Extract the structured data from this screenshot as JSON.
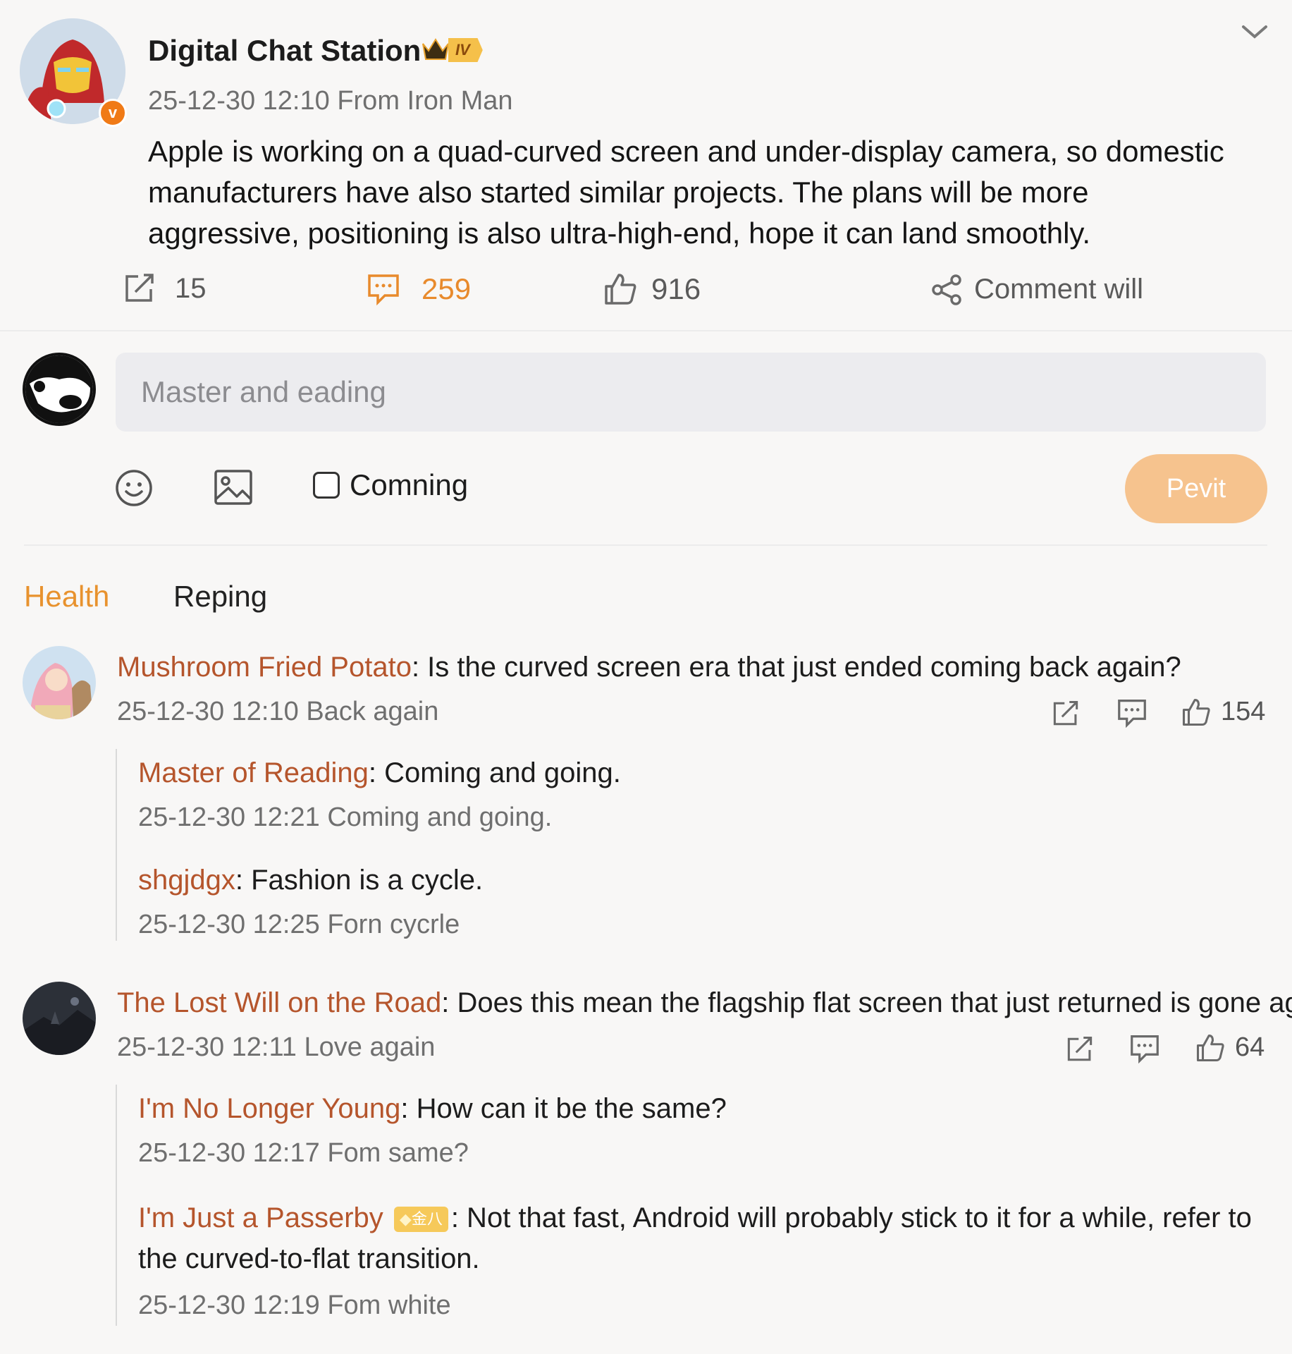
{
  "post": {
    "author": "Digital Chat Station",
    "level_badge": "IV",
    "meta": "25-12-30 12:10 From Iron Man",
    "body": "Apple is working on a quad-curved screen and under-display camera, so domestic manufacturers have also started similar projects. The plans will be more aggressive, positioning is also ultra-high-end, hope it can land smoothly.",
    "actions": {
      "repost_count": "15",
      "comment_count": "259",
      "like_count": "916",
      "share_label": "Comment will"
    },
    "colors": {
      "accent": "#f0a052",
      "link": "#b5552c",
      "comment_count": "#e88a2c"
    }
  },
  "composer": {
    "placeholder": "Master and eading",
    "checkbox_label": "Comning",
    "submit_label": "Pevit"
  },
  "tabs": [
    {
      "label": "Health",
      "active": true
    },
    {
      "label": "Reping",
      "active": false
    }
  ],
  "comments": [
    {
      "author": "Mushroom Fried Potato",
      "text": ": Is the curved screen era that just ended coming back again?",
      "meta": "25-12-30 12:10 Back again",
      "like_count": "154",
      "replies": [
        {
          "author": "Master of Reading",
          "text": ": Coming and going.",
          "meta": "25-12-30 12:21 Coming and going."
        },
        {
          "author": "shgjdgx",
          "text": ": Fashion is a cycle.",
          "meta": "25-12-30 12:25 Forn cycrle"
        }
      ]
    },
    {
      "author": "The Lost Will on the Road",
      "text": ": Does this mean the flagship flat screen that just returned is gone again?",
      "meta": "25-12-30 12:11 Love again",
      "like_count": "64",
      "replies": [
        {
          "author": "I'm No Longer Young",
          "text": ": How can it be the same?",
          "meta": "25-12-30 12:17 Fom same?"
        },
        {
          "author": "I'm Just a Passerby",
          "badge": "金八",
          "text": ": Not that fast, Android will probably stick to it for a while, refer to the curved-to-flat transition.",
          "meta": "25-12-30 12:19 Fom white"
        }
      ]
    }
  ]
}
